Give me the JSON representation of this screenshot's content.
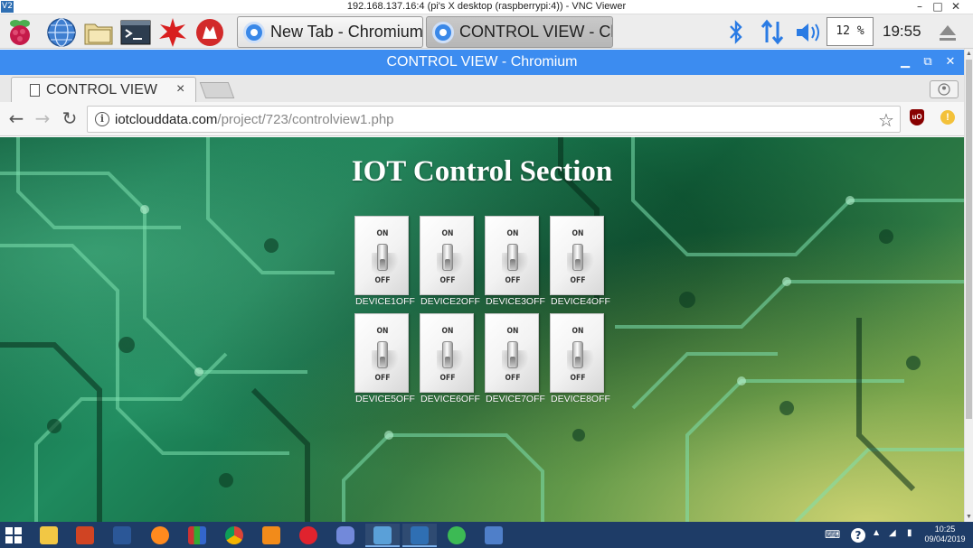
{
  "vnc": {
    "title": "192.168.137.16:4 (pi's X desktop (raspberrypi:4)) - VNC Viewer",
    "logo": "V2",
    "controls": [
      "–",
      "□",
      "✕"
    ]
  },
  "pi_taskbar": {
    "launchers": [
      "raspberry-menu-icon",
      "web-browser-icon",
      "file-manager-icon",
      "terminal-icon",
      "mathematica-icon",
      "wolfram-icon"
    ],
    "windows": [
      {
        "label": "New Tab - Chromium",
        "active": false
      },
      {
        "label": "CONTROL VIEW - Chr...",
        "active": true
      }
    ],
    "tray": [
      "bluetooth-icon",
      "network-icon",
      "volume-icon"
    ],
    "cpu_percent": "12 %",
    "clock": "19:55",
    "eject_icon": "eject-icon"
  },
  "chromium": {
    "window_title": "CONTROL VIEW - Chromium",
    "tab": {
      "label": "CONTROL VIEW",
      "close": "×"
    },
    "address": {
      "domain": "iotclouddata.com",
      "path": "/project/723/controlview1.php"
    },
    "nav": {
      "back": "←",
      "forward": "→",
      "reload": "↻"
    },
    "bookmark_icon": "☆",
    "ublock_label": "uO",
    "ext_label": "!"
  },
  "page": {
    "heading": "IOT Control Section",
    "switch_on_label": "ON",
    "switch_off_label": "OFF",
    "devices": [
      {
        "label": "DEVICE1OFF",
        "state": "off"
      },
      {
        "label": "DEVICE2OFF",
        "state": "off"
      },
      {
        "label": "DEVICE3OFF",
        "state": "off"
      },
      {
        "label": "DEVICE4OFF",
        "state": "off"
      },
      {
        "label": "DEVICE5OFF",
        "state": "off"
      },
      {
        "label": "DEVICE6OFF",
        "state": "off"
      },
      {
        "label": "DEVICE7OFF",
        "state": "off"
      },
      {
        "label": "DEVICE8OFF",
        "state": "off"
      }
    ]
  },
  "windows_taskbar": {
    "apps": [
      "file-explorer-icon",
      "powerpoint-icon",
      "word-icon",
      "firefox-icon",
      "winrar-icon",
      "chrome-icon",
      "uc-browser-icon",
      "opera-icon",
      "discord-icon",
      "photos-icon",
      "vnc-viewer-icon",
      "sync-icon",
      "network-tool-icon"
    ],
    "time": "10:25",
    "date": "09/04/2019",
    "colors": {
      "taskbar": "#1e3c67",
      "chromium_title": "#3c8cf0"
    }
  }
}
